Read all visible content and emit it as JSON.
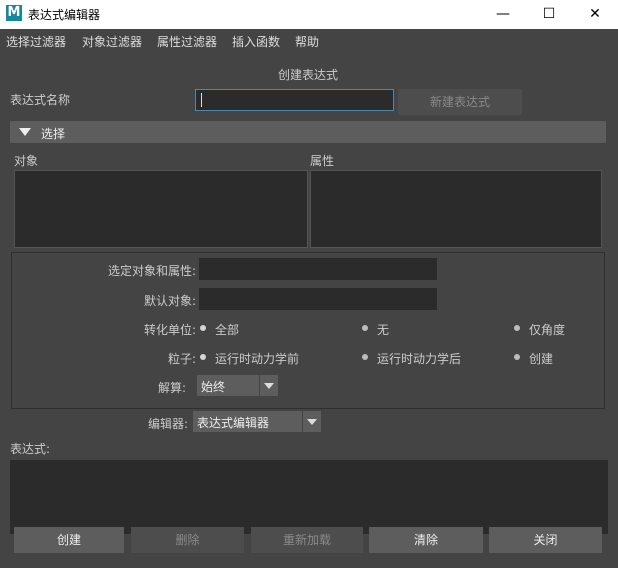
{
  "window": {
    "title": "表达式编辑器",
    "app_icon_letter": "M",
    "minimize": "—",
    "maximize": "☐",
    "close": "✕"
  },
  "menu": [
    "选择过滤器",
    "对象过滤器",
    "属性过滤器",
    "插入函数",
    "帮助"
  ],
  "header": {
    "title": "创建表达式"
  },
  "expr_name": {
    "label": "表达式名称",
    "value": "",
    "new_button": "新建表达式"
  },
  "selection": {
    "section_title": "选择",
    "objects_label": "对象",
    "attributes_label": "属性",
    "selected_label": "选定对象和属性:",
    "selected_value": "",
    "default_object_label": "默认对象:",
    "default_object_value": "",
    "conversion_label": "转化单位:",
    "conversion_options": [
      "全部",
      "无",
      "仅角度"
    ],
    "conversion_selected": "全部",
    "particle_label": "粒子:",
    "particle_options": [
      "运行时动力学前",
      "运行时动力学后",
      "创建"
    ],
    "particle_selected": "运行时动力学前",
    "evaluate_label": "解算:",
    "evaluate_value": "始终"
  },
  "editor": {
    "label": "编辑器:",
    "value": "表达式编辑器"
  },
  "expression": {
    "label": "表达式:",
    "text": ""
  },
  "buttons": {
    "create": "创建",
    "delete": "删除",
    "reload": "重新加载",
    "clear": "清除",
    "close": "关闭"
  },
  "colors": {
    "background": "#444444",
    "field": "#2b2b2b",
    "section": "#5d5d5d",
    "focus": "#5285a6"
  }
}
